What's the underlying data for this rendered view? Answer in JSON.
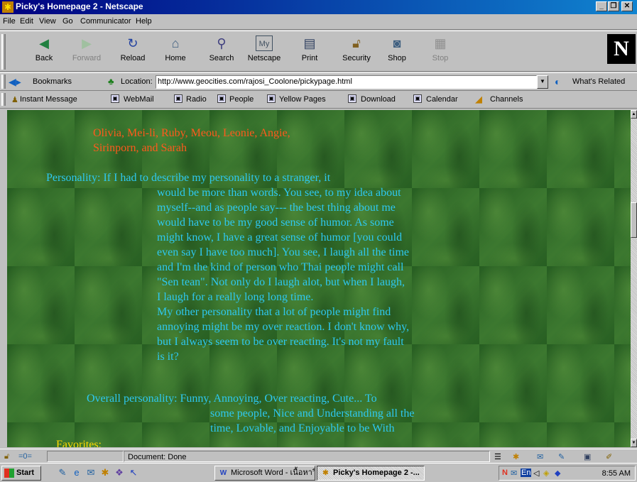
{
  "window": {
    "title": "Picky's Homepage 2 - Netscape",
    "controls": [
      "_",
      "❐",
      "✕"
    ]
  },
  "menu": [
    "File",
    "Edit",
    "View",
    "Go",
    "Communicator",
    "Help"
  ],
  "toolbar": {
    "buttons": [
      {
        "label": "Back",
        "icon": "back-arrow-icon",
        "enabled": true
      },
      {
        "label": "Forward",
        "icon": "forward-arrow-icon",
        "enabled": false
      },
      {
        "label": "Reload",
        "icon": "reload-icon",
        "enabled": true
      },
      {
        "label": "Home",
        "icon": "home-icon",
        "enabled": true
      },
      {
        "label": "Search",
        "icon": "search-icon",
        "enabled": true
      },
      {
        "label": "Netscape",
        "icon": "netscape-icon",
        "enabled": true
      },
      {
        "label": "Print",
        "icon": "printer-icon",
        "enabled": true
      },
      {
        "label": "Security",
        "icon": "lock-icon",
        "enabled": true
      },
      {
        "label": "Shop",
        "icon": "shop-icon",
        "enabled": true
      },
      {
        "label": "Stop",
        "icon": "stop-icon",
        "enabled": false
      }
    ],
    "logo": "N"
  },
  "location_bar": {
    "bookmarks_label": "Bookmarks",
    "location_label": "Location:",
    "url": "http://www.geocities.com/rajosi_Coolone/pickypage.html",
    "whats_related_label": "What's Related"
  },
  "personal_toolbar": {
    "items": [
      "Instant Message",
      "WebMail",
      "Radio",
      "People",
      "Yellow Pages",
      "Download",
      "Calendar",
      "Channels"
    ]
  },
  "page": {
    "names_line1": "Olivia, Mei-li, Ruby, Meou, Leonie, Angie,",
    "names_line2": "Sirinporn, and Sarah",
    "personality_lines": [
      "Personality: If I had to describe my personality to a stranger, it",
      "would be more than words. You see, to my idea about",
      "myself--and as people say--- the best thing about me",
      "would have to be my good sense of humor. As some",
      "might know, I have a great sense of humor [you could",
      "even say I have too much]. You see, I laugh all the time",
      "and I'm the kind of person who Thai people might call",
      "\"Sen tean\". Not only do I laugh alot, but when I laugh,",
      "I laugh for a really long long time.",
      "My other personality that a lot of people might find",
      "annoying might be my over reaction. I don't know why,",
      "but I always seem to be over reacting. It's not my fault",
      "is it?"
    ],
    "overall_lines": [
      "Overall personality: Funny, Annoying, Over reacting, Cute... To",
      "some people, Nice and Understanding all the",
      "time, Lovable, and Enjoyable to be With"
    ],
    "favorites_label": "Favorites:",
    "colors": {
      "names": "#ff5a1c",
      "body": "#2ec8f0",
      "favorites": "#ffd800",
      "background": "#2f6b2a"
    }
  },
  "status": {
    "text": "Document: Done"
  },
  "taskbar": {
    "start_label": "Start",
    "tasks": [
      {
        "label": "Microsoft Word - เนื้อหาวิท...",
        "icon": "word-icon",
        "active": false
      },
      {
        "label": "Picky's Homepage 2 -...",
        "icon": "netscape-icon",
        "active": true
      }
    ],
    "tray_lang": "En",
    "clock": "8:55 AM"
  }
}
